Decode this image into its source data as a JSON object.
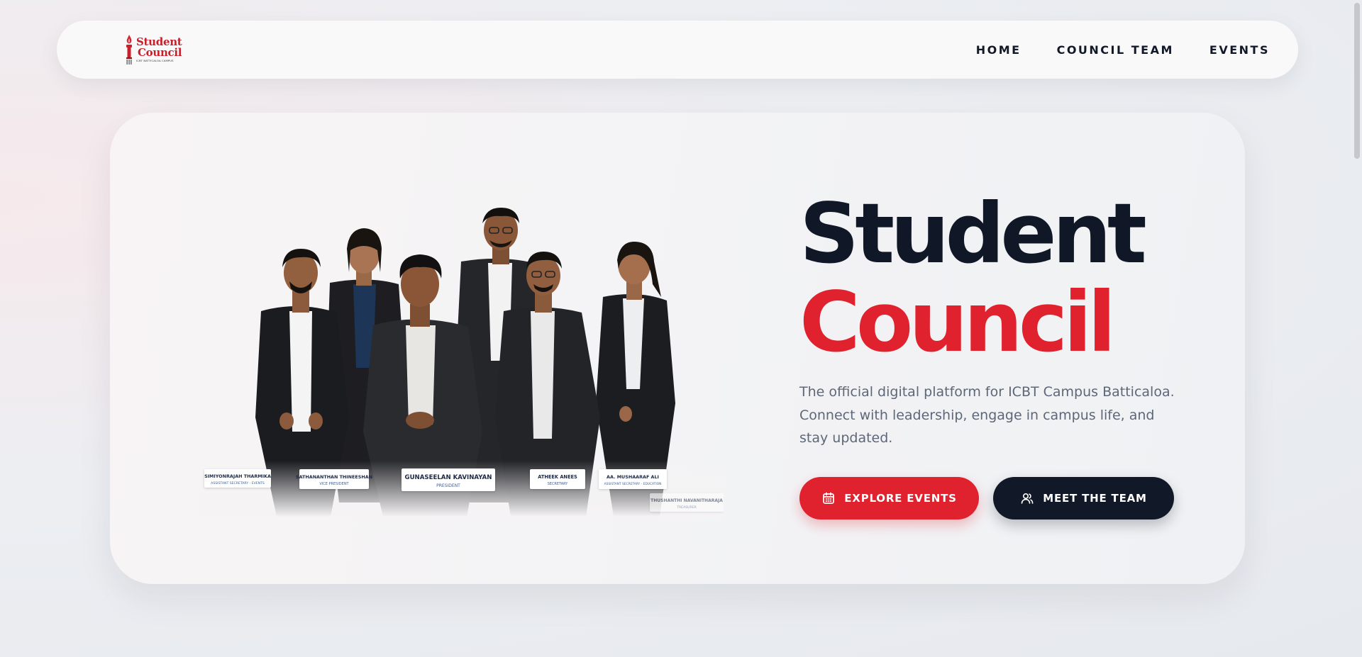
{
  "nav": {
    "logo": {
      "line1": "Student",
      "line2": "Council",
      "tagline": "ICBT BATTICALOA CAMPUS"
    },
    "links": [
      "HOME",
      "COUNCIL TEAM",
      "EVENTS"
    ]
  },
  "hero": {
    "title_line1": "Student",
    "title_line2": "Council",
    "description": "The official digital platform for ICBT Campus Batticaloa. Connect with leadership, engage in campus life, and stay updated.",
    "buttons": {
      "explore": "EXPLORE EVENTS",
      "meet": "MEET THE TEAM"
    },
    "team_cards": [
      {
        "name": "SIMIYONRAJAH THARMIKA",
        "role": "ASSISTANT SECRETARY - EVENTS"
      },
      {
        "name": "SATHANANTHAN THINEESHAN",
        "role": "VICE PRESIDENT"
      },
      {
        "name": "GUNASEELAN KAVINAYAN",
        "role": "PRESIDENT"
      },
      {
        "name": "ATHEEK ANEES",
        "role": "SECRETARY"
      },
      {
        "name": "AA. MUSHAARAF ALI",
        "role": "ASSISTANT SECRETARY - EDUCATION"
      },
      {
        "name": "THUSHANTHI NAVANITHARAJA",
        "role": "TREASURER"
      }
    ]
  },
  "colors": {
    "accent": "#e0222e",
    "dark": "#111827",
    "text_muted": "#5d6778"
  },
  "icons": {
    "explore": "calendar-icon",
    "meet": "users-icon"
  }
}
